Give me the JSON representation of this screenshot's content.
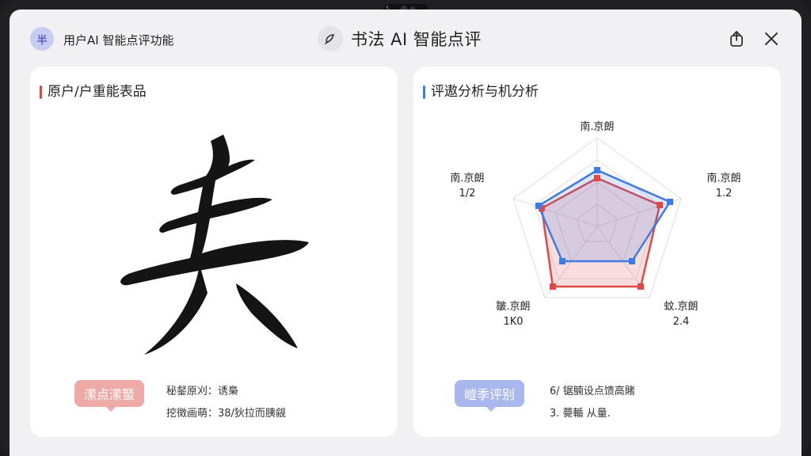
{
  "header": {
    "avatar_char": "半",
    "app_title": "用户AI 智能点评功能",
    "center_title": "书法 AI 智能点评"
  },
  "left_panel": {
    "title": "原户/户重能表品",
    "artwork_char": "夫",
    "badge": "潆点潆蜸",
    "note_1": "秘錖原刈：诱梟",
    "note_2": "挖徵画萌：38/狄拉而胰觎"
  },
  "right_panel": {
    "title": "评遨分析与机分析",
    "badge": "嵦季评别",
    "note_1": "6/ 锯腩设点馈高賭",
    "note_2": "3. 薨輴 从量."
  },
  "radar_labels": [
    {
      "name": "南.京朗",
      "value": ""
    },
    {
      "name": "南.京朗",
      "value": "1.2"
    },
    {
      "name": "蚊.京朗",
      "value": "2.4"
    },
    {
      "name": "皺.京朗",
      "value": "1K0"
    },
    {
      "name": "南.京朗",
      "value": "1/2"
    }
  ],
  "colors": {
    "accent_red": "#e04848",
    "accent_blue": "#3f7be6"
  },
  "icons": {
    "share": "share-icon",
    "close": "close-icon",
    "center": "brush-icon"
  }
}
